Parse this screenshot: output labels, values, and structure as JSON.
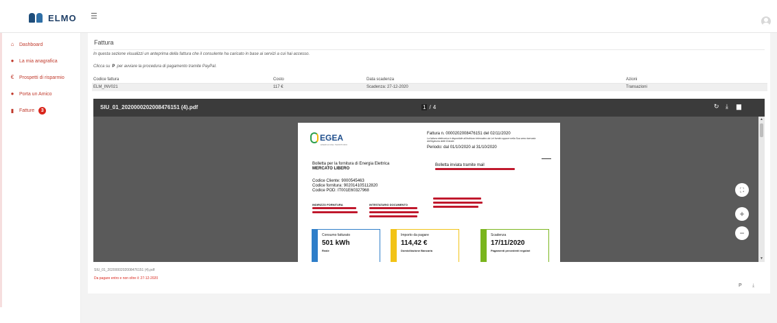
{
  "brand": {
    "name": "ELMO"
  },
  "header": {
    "menu_icon": "hamburger-icon",
    "user_icon": "user-avatar-icon"
  },
  "sidebar": {
    "items": [
      {
        "label": "Dashboard",
        "icon": "home-icon"
      },
      {
        "label": "La mia anagrafica",
        "icon": "person-icon"
      },
      {
        "label": "Prospetti di risparmio",
        "icon": "euro-icon"
      },
      {
        "label": "Porta un Amico",
        "icon": "users-icon"
      },
      {
        "label": "Fatture",
        "icon": "invoice-icon",
        "badge": "3"
      }
    ]
  },
  "main": {
    "title": "Fattura",
    "intro": "In questa sezione visualizzi un anteprima della fattura che il consulente ha caricato in base ai servizi a cui hai accesso.",
    "paypal_prefix": "Clicca su",
    "paypal_icon_glyph": "P",
    "paypal_suffix": "per avviare la procedura di pagamento tramite PayPal.",
    "table": {
      "headers": [
        "Codice fattura",
        "Costo",
        "Data scadenza",
        "Azioni"
      ],
      "row": [
        "ELM_INV021",
        "117 €",
        "Scadenza: 27-12-2020",
        "Transazioni"
      ]
    }
  },
  "viewer": {
    "filename": "SIU_01_2020000202008476151 (4).pdf",
    "page_current": "1",
    "page_separator": "/",
    "page_total": "4",
    "zoom_in": "+",
    "zoom_out": "−",
    "fit_glyph": "⛶",
    "rotate_glyph": "↻",
    "download_glyph": "⤓",
    "print_glyph": "▆",
    "scroll_up": "▲",
    "scroll_down": "▼"
  },
  "invoice": {
    "supplier": "EGEA",
    "supplier_sub": "ENERGIA DEL TERRITORIO",
    "number_line": "Fattura n. 0000202008476151 del 02/11/2020",
    "note": "La fattura elettronica è disponibile all'indirizzo telematico da Lei fornito oppure nella Sua area riservata dell'Agenzia delle Entrate.",
    "period": "Periodo: dal 01/10/2020 al 31/10/2020",
    "supply_line": "Bolletta per la fornitura di Energia Elettrica",
    "market": "MERCATO LIBERO",
    "sent_by": "Bolletta inviata tramite mail",
    "client_code": "Codice Cliente:  9000545463",
    "supply_code": "Codice fornitura:  902014105112820",
    "pod_code": "Codice POD:  IT001E60327968",
    "supply_address_label": "INDIRIZZO FORNITURA",
    "holder_label": "INTESTATARIO DOCUMENTO",
    "box1": {
      "label": "Consumo fatturato",
      "value": "501 kWh",
      "sub": "Reale",
      "color": "#2e7ec9"
    },
    "box2": {
      "label": "Importo da pagare",
      "value": "114,42 €",
      "sub": "Domiciliazione Bancaria",
      "color": "#f2c316"
    },
    "box3": {
      "label": "Scadenza",
      "value": "17/11/2020",
      "sub": "Pagamenti precedenti regolari",
      "color": "#7ab51d"
    }
  },
  "footer": {
    "file": "SIU_01_2020000202008476151 (4).pdf",
    "due": "Da pagare entro e non oltre il: 27-12-2020",
    "paypal_glyph": "P",
    "download_glyph": "⤓"
  }
}
